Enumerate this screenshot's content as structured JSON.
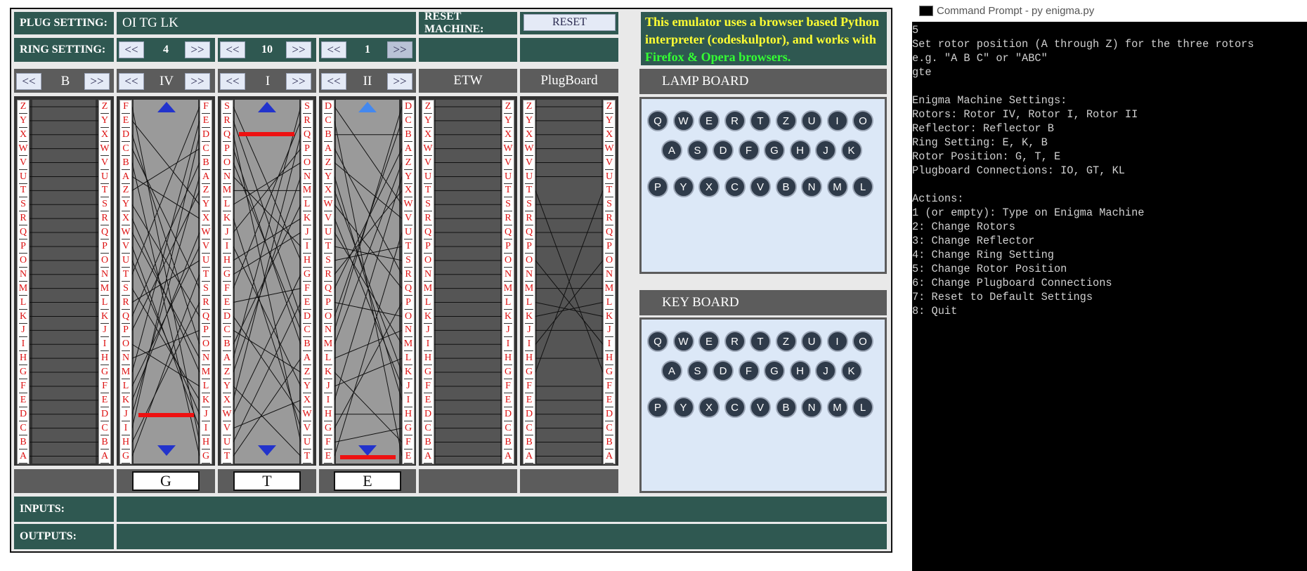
{
  "settings": {
    "plug_label": "PLUG SETTING:",
    "plug_value": "OI TG LK",
    "reset_label": "RESET MACHINE:",
    "reset_button": "RESET",
    "ring_label": "RING SETTING:",
    "prev": "<<",
    "next": ">>",
    "ring_values": [
      "4",
      "10",
      "1"
    ],
    "info_line1": "This emulator uses a browser based Python",
    "info_line2": "interpreter (codeskulptor), and works with",
    "info_line3": "Firefox & Opera browsers."
  },
  "rotors": {
    "reflector_name": "B",
    "names": [
      "IV",
      "I",
      "II"
    ],
    "etw": "ETW",
    "plugboard": "PlugBoard",
    "positions": [
      "G",
      "T",
      "E"
    ]
  },
  "columns": {
    "alphabet_desc": [
      "Z",
      "Y",
      "X",
      "W",
      "V",
      "U",
      "T",
      "S",
      "R",
      "Q",
      "P",
      "O",
      "N",
      "M",
      "L",
      "K",
      "J",
      "I",
      "H",
      "G",
      "F",
      "E",
      "D",
      "C",
      "B",
      "A"
    ],
    "rotor_iv": [
      "F",
      "E",
      "D",
      "C",
      "B",
      "A",
      "Z",
      "Y",
      "X",
      "W",
      "V",
      "U",
      "T",
      "S",
      "R",
      "Q",
      "P",
      "O",
      "N",
      "M",
      "L",
      "K",
      "J",
      "I",
      "H",
      "G"
    ],
    "rotor_i": [
      "S",
      "R",
      "Q",
      "P",
      "O",
      "N",
      "M",
      "L",
      "K",
      "J",
      "I",
      "H",
      "G",
      "F",
      "E",
      "D",
      "C",
      "B",
      "A",
      "Z",
      "Y",
      "X",
      "W",
      "V",
      "U",
      "T"
    ],
    "rotor_ii": [
      "D",
      "C",
      "B",
      "A",
      "Z",
      "Y",
      "X",
      "W",
      "V",
      "U",
      "T",
      "S",
      "R",
      "Q",
      "P",
      "O",
      "N",
      "M",
      "L",
      "K",
      "J",
      "I",
      "H",
      "G",
      "F",
      "E"
    ]
  },
  "io": {
    "inputs_label": "INPUTS:",
    "outputs_label": "OUTPUTS:"
  },
  "lamp_board": {
    "title": "LAMP BOARD",
    "rows": [
      [
        "Q",
        "W",
        "E",
        "R",
        "T",
        "Z",
        "U",
        "I",
        "O"
      ],
      [
        "A",
        "S",
        "D",
        "F",
        "G",
        "H",
        "J",
        "K"
      ],
      [
        "P",
        "Y",
        "X",
        "C",
        "V",
        "B",
        "N",
        "M",
        "L"
      ]
    ]
  },
  "key_board": {
    "title": "KEY BOARD",
    "rows": [
      [
        "Q",
        "W",
        "E",
        "R",
        "T",
        "Z",
        "U",
        "I",
        "O"
      ],
      [
        "A",
        "S",
        "D",
        "F",
        "G",
        "H",
        "J",
        "K"
      ],
      [
        "P",
        "Y",
        "X",
        "C",
        "V",
        "B",
        "N",
        "M",
        "L"
      ]
    ]
  },
  "console": {
    "title": "Command Prompt - py  enigma.py",
    "lines": [
      "5",
      "Set rotor position (A through Z) for the three rotors",
      "e.g. \"A B C\" or \"ABC\"",
      "gte",
      "",
      "Enigma Machine Settings:",
      "Rotors: Rotor IV, Rotor I, Rotor II",
      "Reflector: Reflector B",
      "Ring Setting: E, K, B",
      "Rotor Position: G, T, E",
      "Plugboard Connections: IO, GT, KL",
      "",
      "Actions:",
      "1 (or empty): Type on Enigma Machine",
      "2: Change Rotors",
      "3: Change Reflector",
      "4: Change Ring Setting",
      "5: Change Rotor Position",
      "6: Change Plugboard Connections",
      "7: Reset to Default Settings",
      "8: Quit"
    ]
  },
  "colors": {
    "teal": "#2f5851",
    "gray": "#5c5c5c",
    "letter_red": "#dd1111",
    "marker_red": "#ee1111",
    "arrow_blue": "#2233cc",
    "info_yellow": "#ffff33",
    "info_green": "#33ff33"
  },
  "icons": {
    "console": "command-prompt-icon",
    "rotor_up": "triangle-up-icon",
    "rotor_down": "triangle-down-icon"
  }
}
